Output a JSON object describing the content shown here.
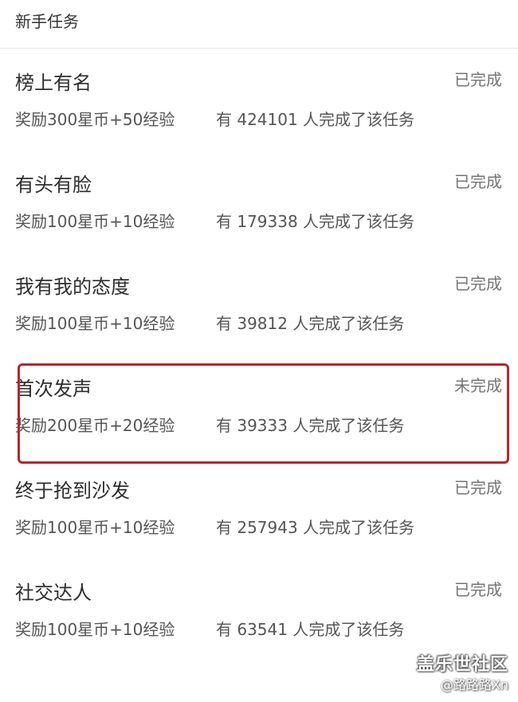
{
  "header": {
    "title": "新手任务"
  },
  "tasks": [
    {
      "title": "榜上有名",
      "status": "已完成",
      "reward": "奖励300星币+50经验",
      "count_text": "有 424101 人完成了该任务"
    },
    {
      "title": "有头有脸",
      "status": "已完成",
      "reward": "奖励100星币+10经验",
      "count_text": "有 179338 人完成了该任务"
    },
    {
      "title": "我有我的态度",
      "status": "已完成",
      "reward": "奖励100星币+10经验",
      "count_text": "有 39812 人完成了该任务"
    },
    {
      "title": "首次发声",
      "status": "未完成",
      "reward": "奖励200星币+20经验",
      "count_text": "有 39333 人完成了该任务"
    },
    {
      "title": "终于抢到沙发",
      "status": "已完成",
      "reward": "奖励100星币+10经验",
      "count_text": "有 257943 人完成了该任务"
    },
    {
      "title": "社交达人",
      "status": "已完成",
      "reward": "奖励100星币+10经验",
      "count_text": "有 63541 人完成了该任务"
    }
  ],
  "highlight": {
    "color": "#b8262b"
  },
  "watermark": {
    "logo": "盖乐世社区",
    "user": "@路路路Xn"
  }
}
